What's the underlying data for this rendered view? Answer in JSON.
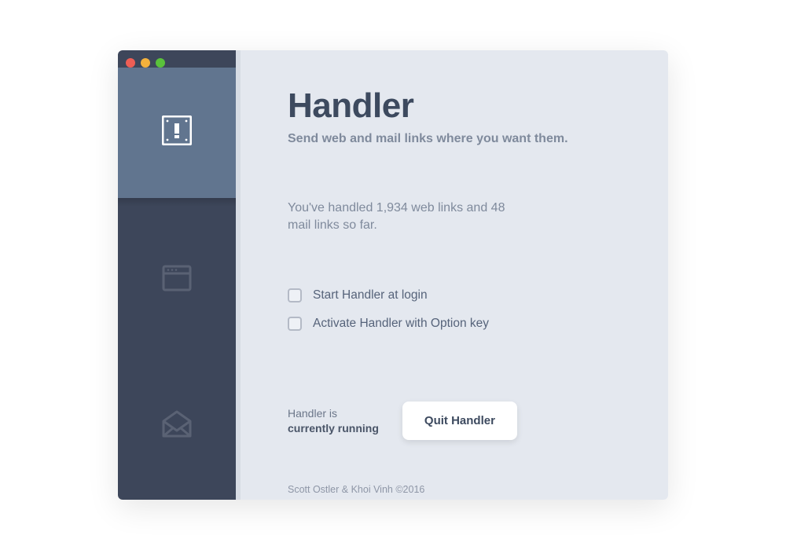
{
  "app": {
    "title": "Handler",
    "subtitle": "Send web and mail links where you want them."
  },
  "sidebar": {
    "items": [
      {
        "name": "general",
        "icon": "app-icon",
        "active": true
      },
      {
        "name": "web",
        "icon": "window-icon",
        "active": false
      },
      {
        "name": "mail",
        "icon": "mail-icon",
        "active": false
      }
    ]
  },
  "stats": {
    "text": "You've handled 1,934 web links and 48 mail links so far.",
    "web_links": 1934,
    "mail_links": 48
  },
  "options": [
    {
      "key": "start_at_login",
      "label": "Start Handler at login",
      "checked": false
    },
    {
      "key": "activate_option_key",
      "label": "Activate Handler with Option key",
      "checked": false
    }
  ],
  "status": {
    "prefix": "Handler is",
    "state": "currently running"
  },
  "actions": {
    "quit": "Quit Handler"
  },
  "credits": "Scott Ostler & Khoi Vinh ©2016"
}
